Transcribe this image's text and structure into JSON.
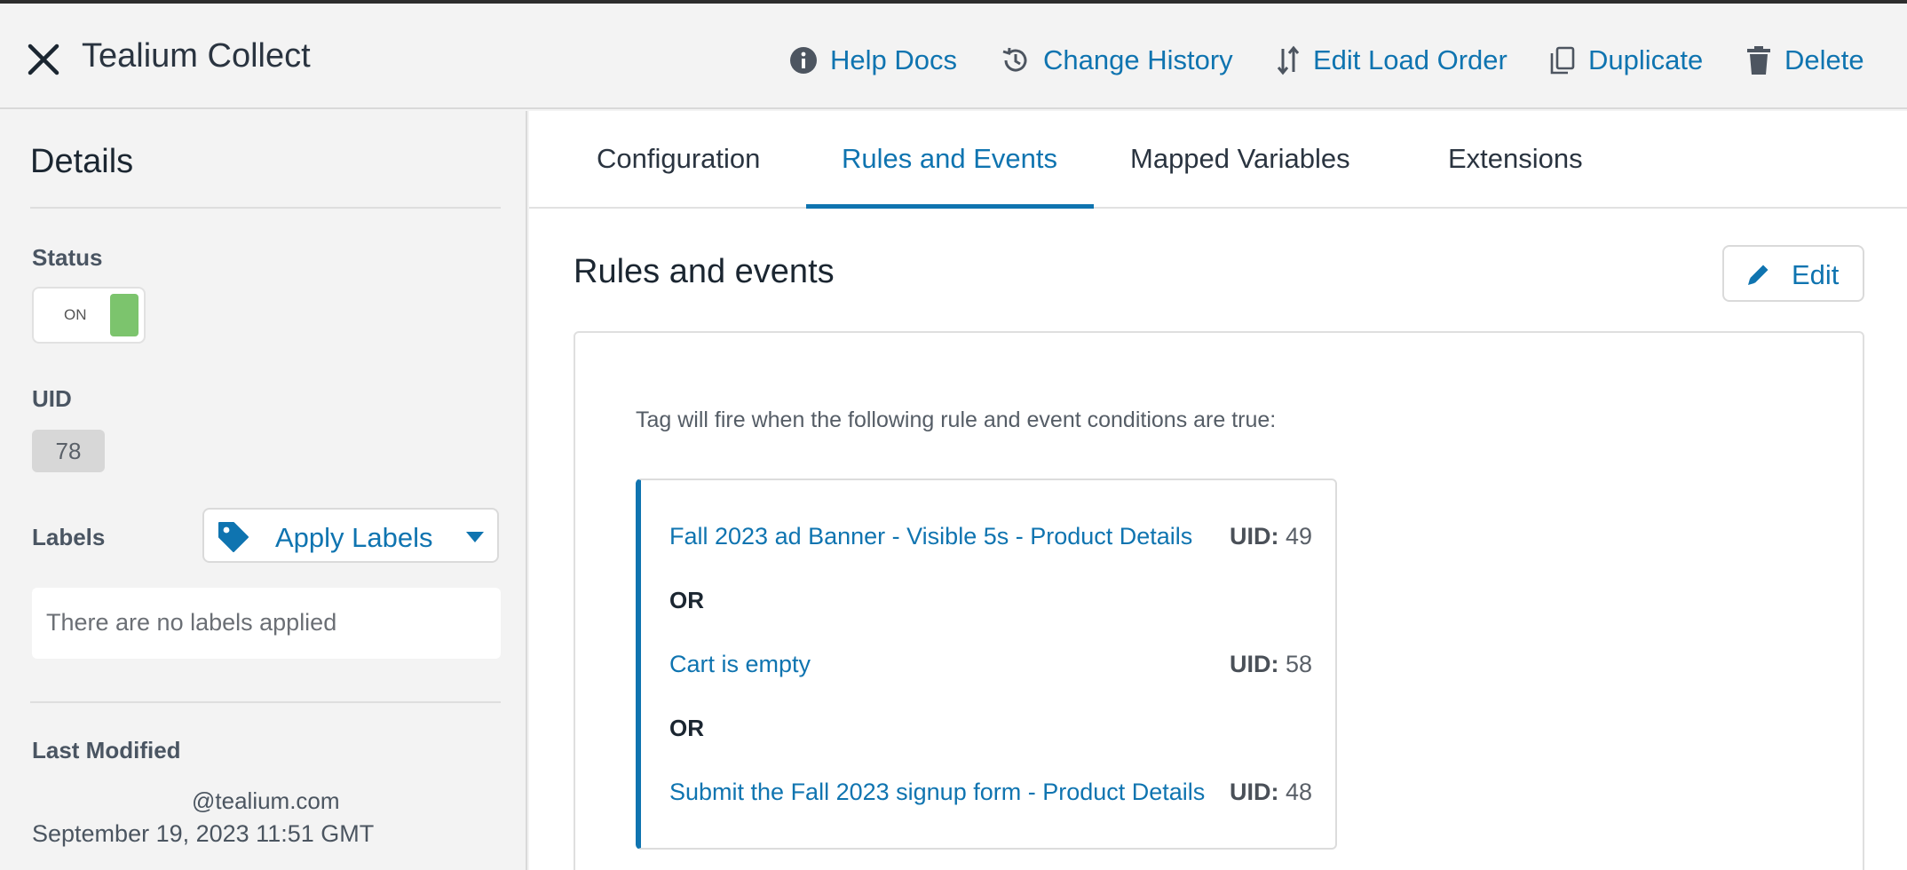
{
  "header": {
    "title": "Tealium Collect",
    "actions": [
      {
        "label": "Help Docs",
        "icon": "info-icon"
      },
      {
        "label": "Change History",
        "icon": "history-icon"
      },
      {
        "label": "Edit Load Order",
        "icon": "sort-icon"
      },
      {
        "label": "Duplicate",
        "icon": "copy-icon"
      },
      {
        "label": "Delete",
        "icon": "trash-icon"
      }
    ]
  },
  "sidebar": {
    "title": "Details",
    "status": {
      "label": "Status",
      "toggle_text": "ON"
    },
    "uid": {
      "label": "UID",
      "value": "78"
    },
    "labels": {
      "label": "Labels",
      "apply_button": "Apply Labels",
      "empty_text": "There are no labels applied"
    },
    "last_modified": {
      "label": "Last Modified",
      "email": "@tealium.com",
      "date": "September 19, 2023 11:51 GMT"
    }
  },
  "tabs": [
    {
      "label": "Configuration",
      "active": false
    },
    {
      "label": "Rules and Events",
      "active": true
    },
    {
      "label": "Mapped Variables",
      "active": false
    },
    {
      "label": "Extensions",
      "active": false
    }
  ],
  "main": {
    "section_title": "Rules and events",
    "edit_label": "Edit",
    "intro": "Tag will fire when the following rule and event conditions are true:",
    "uid_prefix": "UID:",
    "or_label": "OR",
    "rules": [
      {
        "name": "Fall 2023 ad Banner - Visible 5s - Product Details",
        "uid": "49"
      },
      {
        "name": "Cart is empty",
        "uid": "58"
      },
      {
        "name": "Submit the Fall 2023 signup form - Product Details",
        "uid": "48"
      }
    ]
  },
  "colors": {
    "accent": "#0f74b0",
    "toggle_on": "#7cc46d",
    "background": "#f3f3f3"
  }
}
